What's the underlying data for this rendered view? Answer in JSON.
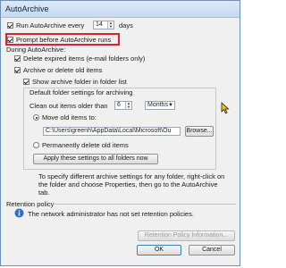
{
  "window": {
    "title": "AutoArchive"
  },
  "run_every": {
    "label": "Run AutoArchive every",
    "value": "14",
    "unit": "days",
    "checked": true
  },
  "prompt_before": {
    "label": "Prompt before AutoArchive runs",
    "checked": true
  },
  "during_autoarchive": {
    "heading": "During AutoArchive:",
    "delete_expired": "Delete expired items (e-mail folders only)",
    "archive_or_delete": "Archive or delete old items",
    "show_archive_folder": "Show archive folder in folder list"
  },
  "defaults_group": {
    "title": "Default folder settings for archiving",
    "clean_out_label": "Clean out items older than",
    "clean_out_value": "6",
    "clean_out_unit": "Months",
    "move_label": "Move old items to:",
    "move_path": "C:\\Users\\greenh\\AppData\\Local\\Microsoft\\Ou",
    "browse_label": "Browse...",
    "permanently_delete": "Permanently delete old items",
    "apply_label": "Apply these settings to all folders now"
  },
  "info_text": "To specify different archive settings for any folder, right-click on the folder and choose Properties, then go to the AutoArchive tab.",
  "retention": {
    "heading": "Retention policy",
    "message": "The network administrator has not set retention policies.",
    "info_button": "Retention Policy Information..."
  },
  "footer": {
    "ok": "OK",
    "cancel": "Cancel"
  },
  "colors": {
    "highlight": "#e0202a",
    "title_bar": "#c6d9ef"
  }
}
